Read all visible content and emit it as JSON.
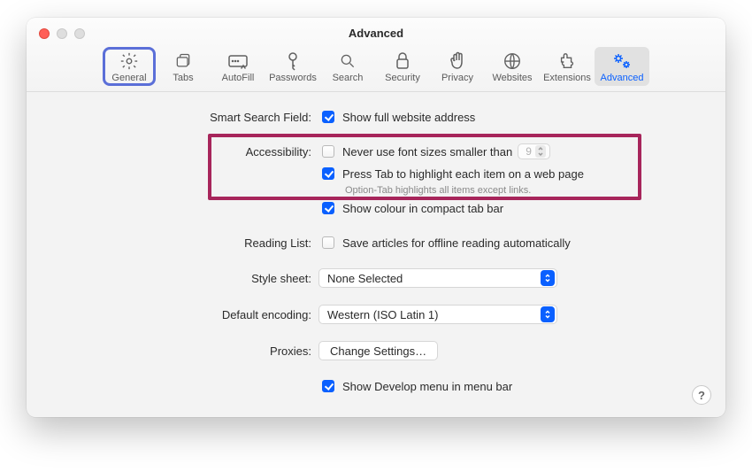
{
  "window": {
    "title": "Advanced"
  },
  "tabs": [
    {
      "id": "general",
      "label": "General"
    },
    {
      "id": "tabs",
      "label": "Tabs"
    },
    {
      "id": "autofill",
      "label": "AutoFill"
    },
    {
      "id": "passwords",
      "label": "Passwords"
    },
    {
      "id": "search",
      "label": "Search"
    },
    {
      "id": "security",
      "label": "Security"
    },
    {
      "id": "privacy",
      "label": "Privacy"
    },
    {
      "id": "websites",
      "label": "Websites"
    },
    {
      "id": "extensions",
      "label": "Extensions"
    },
    {
      "id": "advanced",
      "label": "Advanced"
    }
  ],
  "section_labels": {
    "smart_search": "Smart Search Field:",
    "accessibility": "Accessibility:",
    "reading_list": "Reading List:",
    "style_sheet": "Style sheet:",
    "default_encoding": "Default encoding:",
    "proxies": "Proxies:"
  },
  "options": {
    "show_full_url": {
      "label": "Show full website address",
      "checked": true
    },
    "min_font": {
      "label": "Never use font sizes smaller than",
      "checked": false,
      "value": "9"
    },
    "tab_highlight": {
      "label": "Press Tab to highlight each item on a web page",
      "checked": true,
      "note": "Option-Tab highlights all items except links."
    },
    "compact_tab_colour": {
      "label": "Show colour in compact tab bar",
      "checked": true
    },
    "save_offline": {
      "label": "Save articles for offline reading automatically",
      "checked": false
    },
    "style_sheet_value": "None Selected",
    "encoding_value": "Western (ISO Latin 1)",
    "proxies_button": "Change Settings…",
    "show_develop": {
      "label": "Show Develop menu in menu bar",
      "checked": true
    }
  },
  "colors": {
    "accent": "#0a60ff",
    "highlight_border": "#a7255b",
    "focus_ring": "#5b6fd8"
  }
}
